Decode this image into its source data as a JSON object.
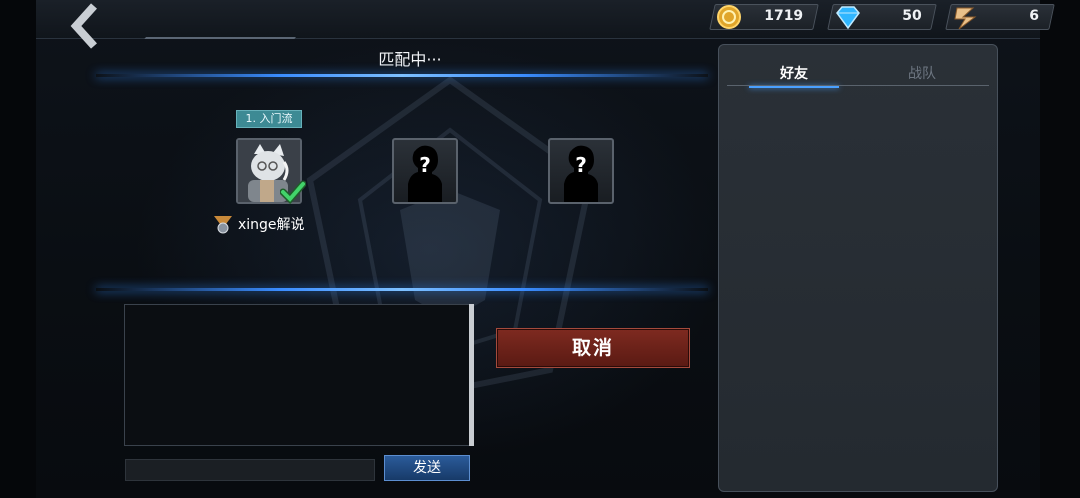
{
  "header": {
    "back_icon": "chevron-left-icon",
    "currencies": [
      {
        "icon": "gold-coin-icon",
        "value": "1719"
      },
      {
        "icon": "diamond-icon",
        "value": "50"
      },
      {
        "icon": "badge-icon",
        "value": "6"
      }
    ]
  },
  "match": {
    "title": "匹配中···",
    "rank_tag": "1. 入门流",
    "player_name": "xinge解说",
    "slots": [
      {
        "state": "ready",
        "icon": "player-avatar-icon"
      },
      {
        "state": "empty",
        "icon": "unknown-player-icon"
      },
      {
        "state": "empty",
        "icon": "unknown-player-icon"
      }
    ]
  },
  "actions": {
    "cancel_label": "取消",
    "send_label": "发送"
  },
  "chat": {
    "input_value": "",
    "messages": []
  },
  "side_panel": {
    "tabs": [
      {
        "label": "好友",
        "active": true
      },
      {
        "label": "战队",
        "active": false
      }
    ]
  },
  "colors": {
    "accent_blue": "#3a8cff",
    "cancel_red": "#7e2a20",
    "rank_tag": "#3d8a94"
  }
}
